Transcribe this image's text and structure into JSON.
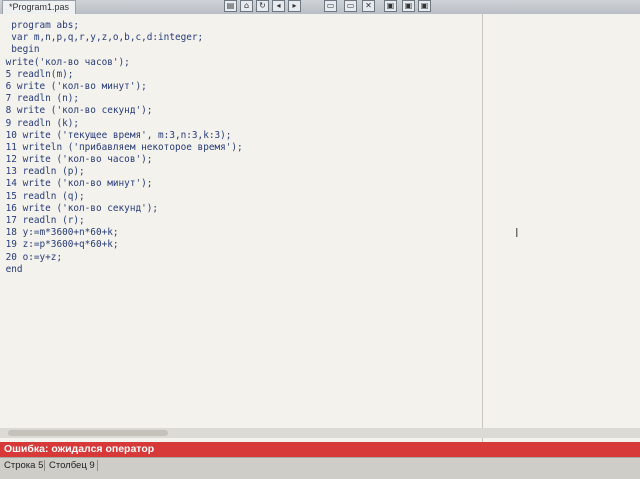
{
  "tab": {
    "title": "*Program1.pas"
  },
  "toolbar": {
    "icons": [
      "print-icon",
      "home-icon",
      "refresh-icon",
      "back-icon",
      "forward-icon",
      "stop-icon",
      "window-icon",
      "window-icon",
      "window-icon"
    ]
  },
  "editor": {
    "lines": [
      "  program abs;",
      "  var m,n,p,q,r,y,z,o,b,c,d:integer;",
      "  begin",
      " write('кол-во часов');",
      " 5 readln(m);",
      " 6 write ('кол-во минут');",
      " 7 readln (n);",
      " 8 write ('кол-во секунд');",
      " 9 readln (k);",
      " 10 write ('текущее время', m:3,n:3,k:3);",
      " 11 writeln ('прибавляем некоторое время');",
      " 12 write ('кол-во часов');",
      " 13 readln (p);",
      " 14 write ('кол-во минут');",
      " 15 readln (q);",
      " 16 write ('кол-во секунд');",
      " 17 readln (r);",
      " 18 y:=m*3600+n*60+k;",
      " 19 z:=p*3600+q*60+k;",
      " 20 o:=y+z;",
      " end"
    ]
  },
  "error": {
    "message": "Ошибка: ожидался оператор"
  },
  "status": {
    "line": "Строка 5",
    "column": "Столбец 9"
  }
}
